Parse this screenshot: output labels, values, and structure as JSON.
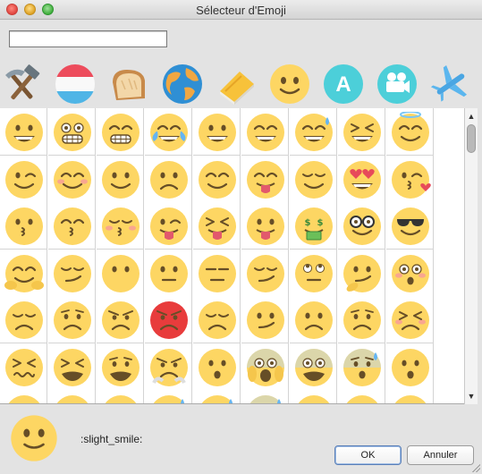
{
  "window": {
    "title": "Sélecteur d'Emoji"
  },
  "search": {
    "value": "",
    "placeholder": ""
  },
  "categories": [
    {
      "icon": "hammer-pick-icon",
      "name": "objects"
    },
    {
      "icon": "flag-luxembourg-icon",
      "name": "flags"
    },
    {
      "icon": "bread-icon",
      "name": "food"
    },
    {
      "icon": "globe-icon",
      "name": "nature"
    },
    {
      "icon": "notebook-icon",
      "name": "symbols"
    },
    {
      "icon": "smiley-icon",
      "name": "people"
    },
    {
      "icon": "letter-a-icon",
      "name": "regional"
    },
    {
      "icon": "camera-icon",
      "name": "activity"
    },
    {
      "icon": "airplane-icon",
      "name": "travel"
    }
  ],
  "emoji_rows": [
    [
      "grinning",
      "grimacing",
      "grin",
      "joy",
      "smiley",
      "smile",
      "sweat_smile",
      "laughing",
      "innocent"
    ],
    [
      "wink",
      "blush",
      "slight_smile",
      "upside_down",
      "relaxed",
      "yum",
      "relieved",
      "heart_eyes",
      "kissing_heart"
    ],
    [
      "kissing",
      "kissing_smiling_eyes",
      "kissing_closed_eyes",
      "stuck_out_tongue_winking_eye",
      "stuck_out_tongue_closed_eyes",
      "stuck_out_tongue",
      "money_mouth",
      "nerd",
      "sunglasses"
    ],
    [
      "hugging",
      "smirk",
      "no_mouth",
      "neutral_face",
      "expressionless",
      "unamused",
      "rolling_eyes",
      "thinking",
      "flushed"
    ],
    [
      "disappointed",
      "worried",
      "angry",
      "rage",
      "pensive",
      "confused",
      "slight_frown",
      "frowning2",
      "persevere"
    ],
    [
      "confounded",
      "tired_face",
      "weary",
      "triumph",
      "open_mouth",
      "scream",
      "fearful",
      "cold_sweat",
      "hushed"
    ],
    [
      "frowning",
      "anguished",
      "cry",
      "disappointed_relieved",
      "sleepy",
      "sweat",
      "sob",
      "dizzy_face",
      "astonished"
    ]
  ],
  "preview": {
    "icon": "slight-smile-icon",
    "shortcode": ":slight_smile:"
  },
  "buttons": {
    "ok": "OK",
    "cancel": "Annuler"
  },
  "colors": {
    "face": "#fdd663",
    "face_dark": "#664e27",
    "blush": "#f79a9a",
    "rage": "#e83c3c",
    "accent": "#5a7fb7"
  }
}
